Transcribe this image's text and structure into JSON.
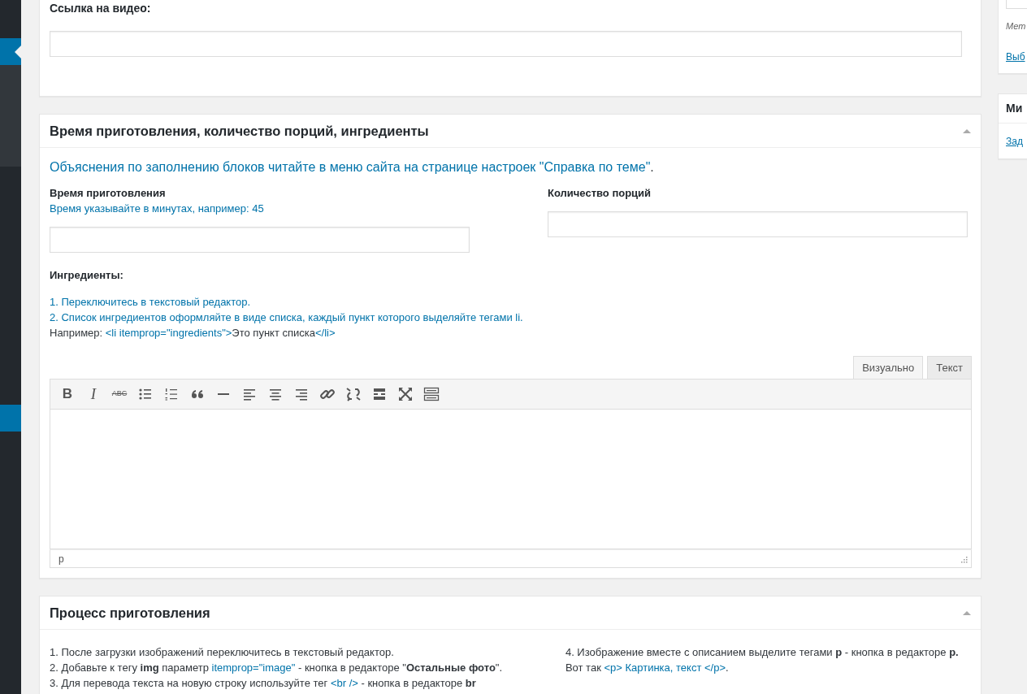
{
  "sidebar": {
    "items": [
      {
        "kind": "menu",
        "selected": false
      },
      {
        "kind": "menu",
        "selected": true
      },
      {
        "kind": "submenu",
        "selected": false
      },
      {
        "kind": "menu",
        "selected": false
      },
      {
        "kind": "menu",
        "selected": true
      },
      {
        "kind": "menu",
        "selected": false
      }
    ]
  },
  "video_box": {
    "label": "Ссылка на видео:"
  },
  "details_box": {
    "title": "Время приготовления, количество порций, ингредиенты",
    "expanded": true,
    "note": [
      {
        "text": "Объяснения по заполнению блоков читайте в меню сайта на странице настроек \"Справка по теме\"",
        "link": true
      },
      {
        "text": ".",
        "link": false
      }
    ],
    "fields": [
      {
        "label": "Время приготовления",
        "hint": "Время указывайте в минутах, например: 45"
      },
      {
        "label": "Количество порций"
      }
    ],
    "ingredients": {
      "label": "Ингредиенты:",
      "lines": [
        [
          {
            "text": "1. Переключитесь в текстовый редактор.",
            "link": true
          }
        ],
        [
          {
            "text": "2. Список ингредиентов оформляйте в виде списка, каждый пункт которого выделяйте тегами li.",
            "link": true
          }
        ],
        [
          {
            "text": "Например: ",
            "link": false
          },
          {
            "text": "<li itemprop=\"ingredients\">",
            "link": true
          },
          {
            "text": "Это пункт списка",
            "link": false
          },
          {
            "text": "</li>",
            "link": true
          }
        ]
      ]
    },
    "editor": {
      "tabs": [
        {
          "label": "Визуально",
          "selected": true
        },
        {
          "label": "Текст",
          "selected": false
        }
      ],
      "toolbar": [
        {
          "kind": "bold",
          "label": "B"
        },
        {
          "kind": "italic",
          "label": "I"
        },
        {
          "kind": "strike",
          "label": "ABC"
        },
        {
          "kind": "bullets"
        },
        {
          "kind": "numbers"
        },
        {
          "kind": "quote"
        },
        {
          "kind": "rule"
        },
        {
          "kind": "align-left"
        },
        {
          "kind": "align-center"
        },
        {
          "kind": "align-right"
        },
        {
          "kind": "link"
        },
        {
          "kind": "unlink"
        },
        {
          "kind": "more"
        },
        {
          "kind": "fullscreen"
        },
        {
          "kind": "toolbar"
        }
      ],
      "path": "p"
    }
  },
  "process_box": {
    "title": "Процесс приготовления",
    "expanded": true,
    "columns": [
      [
        [
          {
            "text": "1. После загрузки изображений переключитесь в текстовый редактор.",
            "link": false
          }
        ],
        [
          {
            "text": "2. Добавьте к тегу **img** параметр ",
            "link": false
          },
          {
            "text": "itemprop=\"image\"",
            "link": true
          },
          {
            "text": " - кнопка в редакторе \"**Остальные фото**\".",
            "link": false
          }
        ],
        [
          {
            "text": "3. Для перевода текста на новую строку используйте тег ",
            "link": false
          },
          {
            "text": "<br />",
            "link": true
          },
          {
            "text": " - кнопка в редакторе **br**",
            "link": false
          }
        ]
      ],
      [
        [
          {
            "text": "4. Изображение вместе с описанием выделите тегами **p** - кнопка в редакторе **p.**",
            "link": false
          }
        ],
        [
          {
            "text": "Вот так ",
            "link": false
          },
          {
            "text": "<p> Картинка, текст </p>",
            "link": true
          },
          {
            "text": ".",
            "link": false
          }
        ]
      ]
    ]
  },
  "right_column": {
    "boxes": [
      {
        "caption": "Мет",
        "link": "Выб"
      },
      {
        "title": "Ми",
        "link": "Зад"
      }
    ]
  }
}
